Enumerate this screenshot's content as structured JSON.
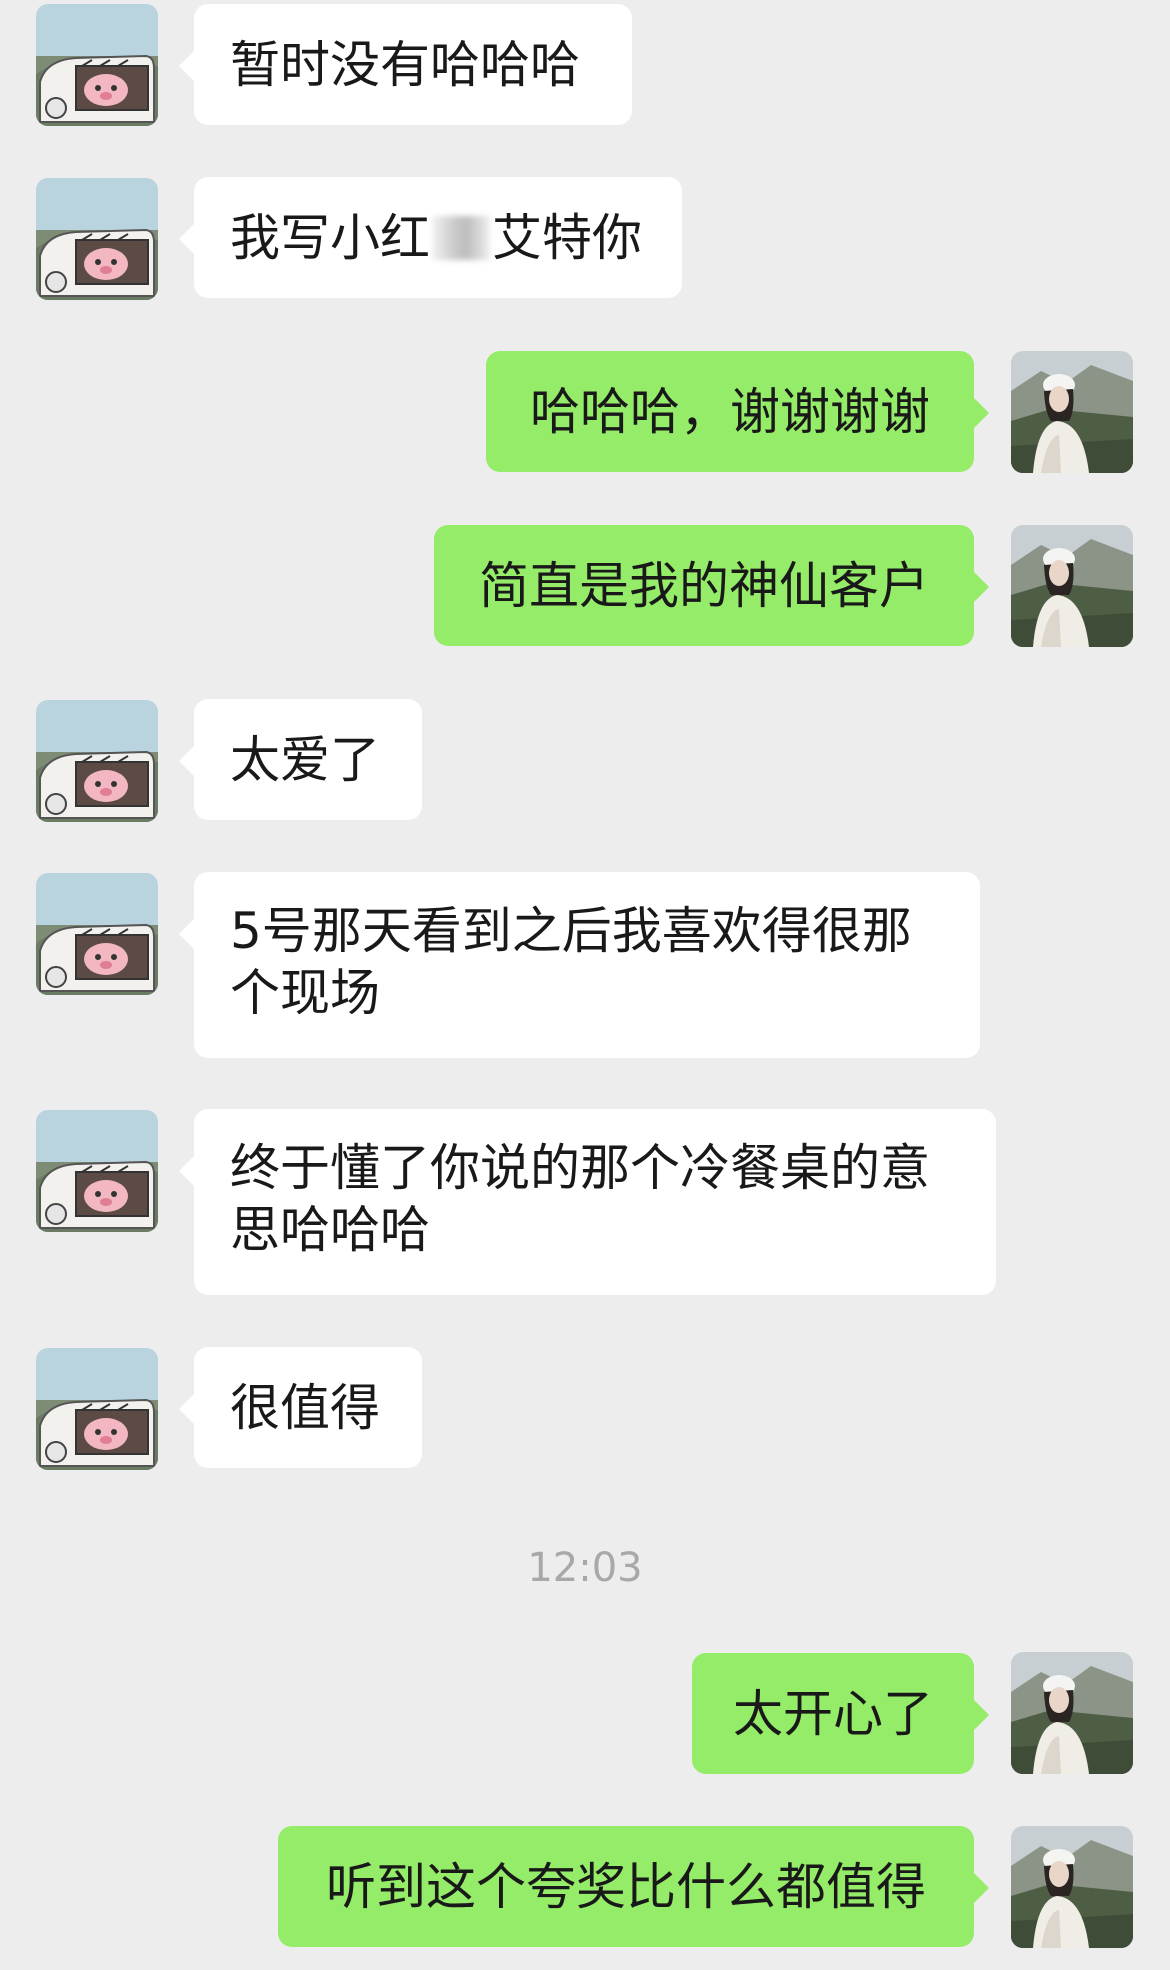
{
  "chat": {
    "messages": [
      {
        "sender": "contact",
        "text": "暂时没有哈哈哈"
      },
      {
        "sender": "contact",
        "text_before": "我写小红",
        "text_after": "艾特你"
      },
      {
        "sender": "me",
        "text": "哈哈哈，谢谢谢谢"
      },
      {
        "sender": "me",
        "text": "简直是我的神仙客户"
      },
      {
        "sender": "contact",
        "text": "太爱了"
      },
      {
        "sender": "contact",
        "text": "5号那天看到之后我喜欢得很那个现场"
      },
      {
        "sender": "contact",
        "text": "终于懂了你说的那个冷餐桌的意思哈哈哈"
      },
      {
        "sender": "contact",
        "text": "很值得"
      },
      {
        "sender": "me",
        "text": "太开心了"
      },
      {
        "sender": "me",
        "text": "听到这个夸奖比什么都值得"
      }
    ],
    "timestamp": "12:03"
  },
  "colors": {
    "background": "#ededed",
    "incoming_bubble": "#ffffff",
    "outgoing_bubble": "#95ec69",
    "timestamp_text": "#a8a8a8"
  },
  "icons": {
    "contact_avatar": "cartoon-car-pig-avatar",
    "my_avatar": "mountain-portrait-avatar"
  }
}
